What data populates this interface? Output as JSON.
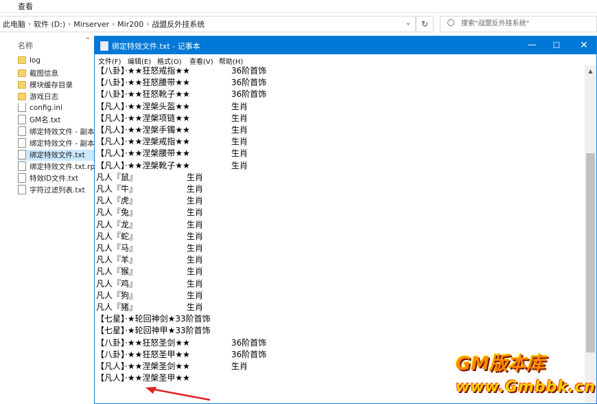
{
  "explorer": {
    "menu": "查看",
    "breadcrumb": [
      "此电脑",
      "软件 (D:)",
      "Mirserver",
      "Mir200",
      "战盟反外挂系统"
    ],
    "search_placeholder": "搜索\"战盟反外挂系统\"",
    "column_header": "名称",
    "files": [
      {
        "name": "log",
        "type": "folder"
      },
      {
        "name": "截图信息",
        "type": "folder"
      },
      {
        "name": "模块缓存目录",
        "type": "folder"
      },
      {
        "name": "游戏日志",
        "type": "folder"
      },
      {
        "name": "config.ini",
        "type": "file"
      },
      {
        "name": "GM名.txt",
        "type": "file"
      },
      {
        "name": "绑定特效文件 - 副本.",
        "type": "file"
      },
      {
        "name": "绑定特效文件 - 副本.",
        "type": "file"
      },
      {
        "name": "绑定特效文件.txt",
        "type": "file",
        "selected": true
      },
      {
        "name": "绑定特效文件.txt.rpk",
        "type": "file"
      },
      {
        "name": "特效ID文件.txt",
        "type": "file"
      },
      {
        "name": "字符过滤列表.txt",
        "type": "file"
      }
    ]
  },
  "notepad": {
    "title": "绑定特效文件.txt - 记事本",
    "menu": [
      "文件(F)",
      "编辑(E)",
      "格式(O)",
      "查看(V)",
      "帮助(H)"
    ],
    "lines": [
      {
        "a": "【八卦】·★★狂怒戒指★★",
        "b": "36阶首饰",
        "col": 197
      },
      {
        "a": "【八卦】·★★狂怒腰带★★",
        "b": "36阶首饰",
        "col": 197
      },
      {
        "a": "【八卦】·★★狂怒靴子★★",
        "b": "36阶首饰",
        "col": 197
      },
      {
        "a": "【凡人】·★★涅槃头盔★★",
        "b": "生肖",
        "col": 197
      },
      {
        "a": "【凡人】·★★涅槃项链★★",
        "b": "生肖",
        "col": 197
      },
      {
        "a": "【凡人】·★★涅槃手镯★★",
        "b": "生肖",
        "col": 197
      },
      {
        "a": "【凡人】·★★涅槃戒指★★",
        "b": "生肖",
        "col": 197
      },
      {
        "a": "【凡人】·★★涅槃腰带★★",
        "b": "生肖",
        "col": 197
      },
      {
        "a": "【凡人】·★★涅槃靴子★★",
        "b": "生肖",
        "col": 197
      },
      {
        "a": "凡人『鼠』",
        "b": "生肖",
        "col": 132
      },
      {
        "a": "凡人『牛』",
        "b": "生肖",
        "col": 132
      },
      {
        "a": "凡人『虎』",
        "b": "生肖",
        "col": 132
      },
      {
        "a": "凡人『兔』",
        "b": "生肖",
        "col": 132
      },
      {
        "a": "凡人『龙』",
        "b": "生肖",
        "col": 132
      },
      {
        "a": "凡人『蛇』",
        "b": "生肖",
        "col": 132
      },
      {
        "a": "凡人『马』",
        "b": "生肖",
        "col": 132
      },
      {
        "a": "凡人『羊』",
        "b": "生肖",
        "col": 132
      },
      {
        "a": "凡人『猴』",
        "b": "生肖",
        "col": 132
      },
      {
        "a": "凡人『鸡』",
        "b": "生肖",
        "col": 132
      },
      {
        "a": "凡人『狗』",
        "b": "生肖",
        "col": 132
      },
      {
        "a": "凡人『猪』",
        "b": "生肖",
        "col": 132
      },
      {
        "a": "【七星】·★轮回神剑★33阶首饰",
        "b": "",
        "col": 0
      },
      {
        "a": "【七星】·★轮回神甲★33阶首饰",
        "b": "",
        "col": 0
      },
      {
        "a": "【八卦】·★★狂怒圣剑★★",
        "b": "36阶首饰",
        "col": 197
      },
      {
        "a": "【八卦】·★★狂怒圣甲★★",
        "b": "36阶首饰",
        "col": 197
      },
      {
        "a": "【凡人】·★★涅槃圣剑★★",
        "b": "生肖",
        "col": 197
      },
      {
        "a": "【凡人】·★★涅槃圣甲★★",
        "b": "",
        "col": 0
      }
    ]
  },
  "watermark": {
    "top": "GM版本库",
    "bottom": "www.Gmbbk.cn"
  },
  "colors": {
    "titlebar": "#0078d7",
    "selection": "#cce8ff",
    "arrow": "#e02020"
  }
}
